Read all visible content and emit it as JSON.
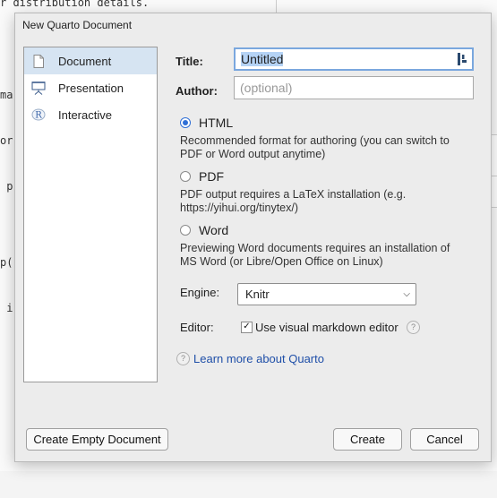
{
  "background": {
    "top_line": "r distribution details.",
    "code_lines": [
      "",
      "",
      "ma",
      "or",
      " p",
      "",
      "p(",
      " i"
    ]
  },
  "dialog": {
    "title": "New Quarto Document",
    "doc_types": [
      {
        "label": "Document",
        "icon": "document-icon",
        "selected": true
      },
      {
        "label": "Presentation",
        "icon": "presentation-icon",
        "selected": false
      },
      {
        "label": "Interactive",
        "icon": "r-logo-icon",
        "selected": false
      }
    ],
    "title_field": {
      "label": "Title:",
      "value": "Untitled"
    },
    "author_field": {
      "label": "Author:",
      "placeholder": "(optional)"
    },
    "formats": [
      {
        "label": "HTML",
        "selected": true,
        "desc_1": "Recommended format for authoring (you can switch to",
        "desc_2": "PDF or Word output anytime)"
      },
      {
        "label": "PDF",
        "selected": false,
        "desc_1": "PDF output requires a LaTeX installation (e.g.",
        "desc_2": "https://yihui.org/tinytex/)"
      },
      {
        "label": "Word",
        "selected": false,
        "desc_1": "Previewing Word documents requires an installation of",
        "desc_2": "MS Word (or Libre/Open Office on Linux)"
      }
    ],
    "engine": {
      "label": "Engine:",
      "value": "Knitr"
    },
    "editor": {
      "label": "Editor:",
      "checkbox_label": "Use visual markdown editor",
      "checked": true
    },
    "learn_more": "Learn more about Quarto",
    "buttons": {
      "create_empty": "Create Empty Document",
      "create": "Create",
      "cancel": "Cancel"
    },
    "accent_color": "#2f6fd6"
  }
}
